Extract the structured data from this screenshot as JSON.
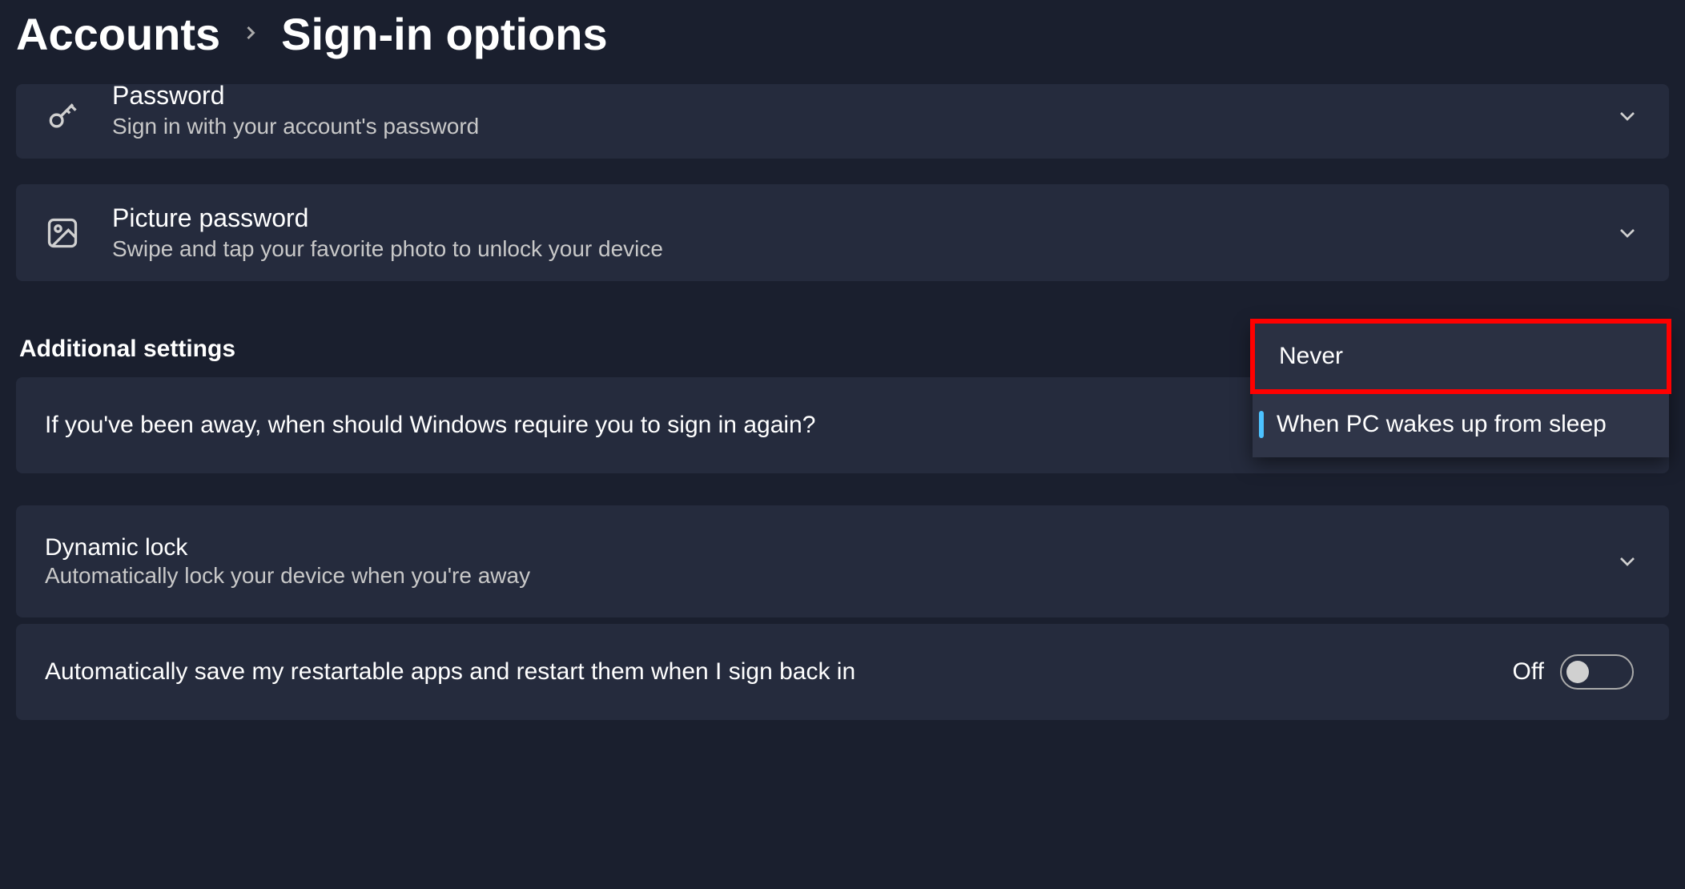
{
  "breadcrumb": {
    "parent": "Accounts",
    "current": "Sign-in options"
  },
  "cards": {
    "password": {
      "title": "Password",
      "desc": "Sign in with your account's password"
    },
    "picture": {
      "title": "Picture password",
      "desc": "Swipe and tap your favorite photo to unlock your device"
    }
  },
  "section_header": "Additional settings",
  "signin_again": {
    "label": "If you've been away, when should Windows require you to sign in again?",
    "option_never": "Never",
    "option_wake": "When PC wakes up from sleep"
  },
  "dynamic_lock": {
    "title": "Dynamic lock",
    "desc": "Automatically lock your device when you're away"
  },
  "restart_apps": {
    "label": "Automatically save my restartable apps and restart them when I sign back in",
    "state": "Off"
  }
}
